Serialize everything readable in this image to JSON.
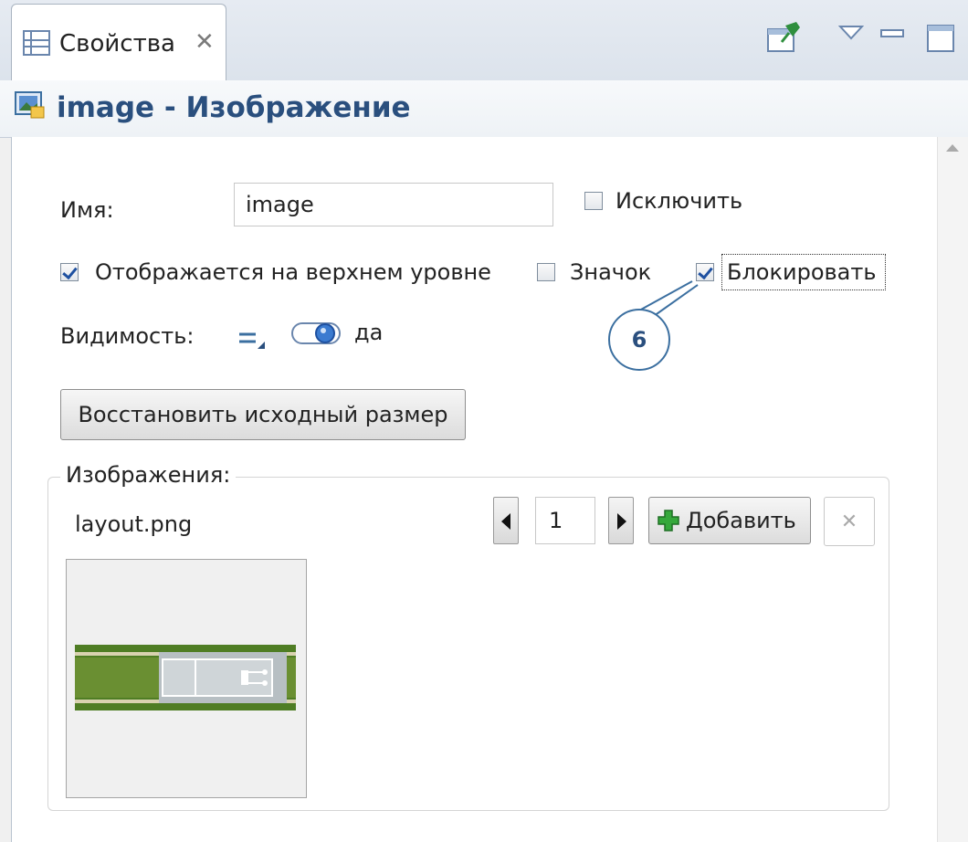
{
  "tab": {
    "title": "Свойства",
    "close_glyph": "✕"
  },
  "toolbar": {
    "icons": [
      "pin-icon",
      "view-menu-icon",
      "minimize-icon",
      "maximize-icon"
    ]
  },
  "header": {
    "title": "image - Изображение",
    "icon": "image-element-icon"
  },
  "form": {
    "name_label": "Имя:",
    "name_value": "image",
    "exclude_label": "Исключить",
    "exclude_checked": false,
    "top_level_label": "Отображается на верхнем уровне",
    "top_level_checked": true,
    "icon_label": "Значок",
    "icon_checked": false,
    "lock_label": "Блокировать",
    "lock_checked": true,
    "visibility_label": "Видимость:",
    "visibility_value": "да",
    "reset_size_button": "Восстановить исходный размер"
  },
  "images": {
    "group_label": "Изображения:",
    "file_name": "layout.png",
    "index_value": "1",
    "add_button": "Добавить",
    "delete_glyph": "✕"
  },
  "callout": {
    "number": "6"
  },
  "colors": {
    "header_text": "#2a4f7e",
    "accent": "#3b6fa0",
    "check": "#1e50a0"
  }
}
